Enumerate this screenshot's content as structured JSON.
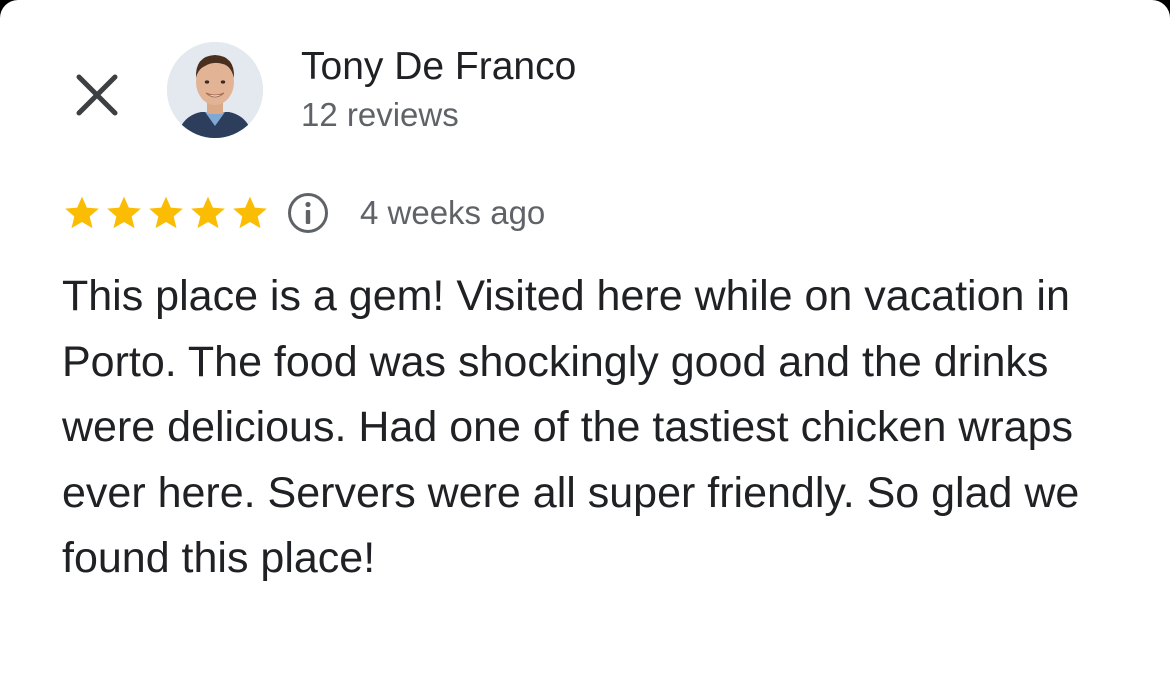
{
  "reviewer": {
    "name": "Tony De Franco",
    "review_count": "12 reviews",
    "avatar_icon": "person-avatar-photo"
  },
  "close_icon": "close-icon",
  "rating": {
    "stars": 5,
    "max_stars": 5,
    "star_color": "#fbbc04",
    "info_icon": "info-icon",
    "date": "4 weeks ago"
  },
  "review": {
    "text": "This place is a gem! Visited here while on vacation in Porto. The food was shockingly good and the drinks were delicious. Had one of the tastiest chicken wraps ever here. Servers were all super friendly. So glad we found this place!"
  }
}
